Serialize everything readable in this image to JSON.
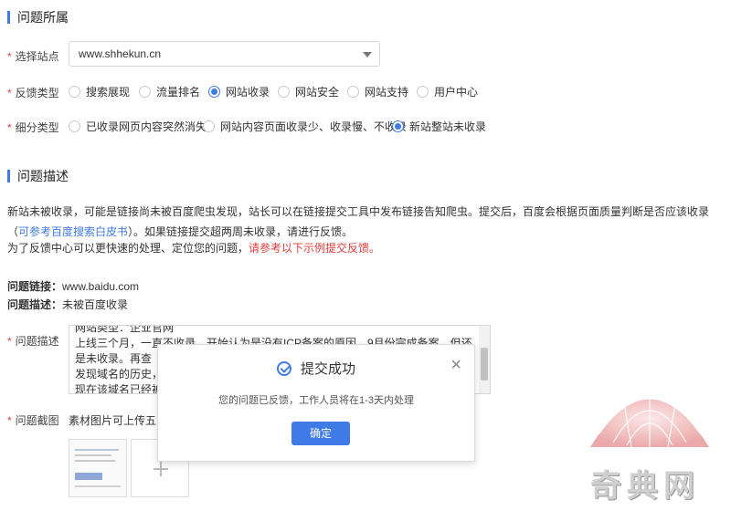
{
  "section1": {
    "title": "问题所属"
  },
  "site": {
    "label": "选择站点",
    "value": "www.shhekun.cn"
  },
  "feedback_type": {
    "label": "反馈类型",
    "options": [
      "搜索展现",
      "流量排名",
      "网站收录",
      "网站安全",
      "网站支持",
      "用户中心"
    ],
    "selected": "网站收录"
  },
  "sub_type": {
    "label": "细分类型",
    "options": [
      "已收录网页内容突然消失",
      "网站内容页面收录少、收录慢、不收录",
      "新站整站未收录"
    ],
    "selected": "新站整站未收录"
  },
  "section2": {
    "title": "问题描述"
  },
  "intro": {
    "text1": "新站未被收录，可能是链接尚未被百度爬虫发现，站长可以在链接提交工具中发布链接告知爬虫。提交后，百度会根据页面质量判断是否应该收录（",
    "link": "可参考百度搜索白皮书",
    "text2": "）。如果链接提交超两周未收录，请进行反馈。",
    "line2_prefix": "为了反馈中心可以更快速的处理、定位您的问题，",
    "line2_red": "请参考以下示例提交反馈。"
  },
  "example": {
    "link_label": "问题链接：",
    "link_value": "www.baidu.com",
    "desc_label": "问题描述：",
    "desc_value": "未被百度收录"
  },
  "description": {
    "label": "问题描述",
    "value": "网站类型：企业官网\n上线三个月，一直不收录，开始认为是没有ICP备案的原因，9月份完成备案，但还是未收录。再查\n发现域名的历史，在\n现在该域名已经被合\n理员给予本网站重新"
  },
  "screenshot": {
    "label": "问题截图",
    "tip": "素材图片可上传五张，"
  },
  "modal": {
    "title": "提交成功",
    "message": "您的问题已反馈，工作人员将在1-3天内处理",
    "confirm": "确定",
    "close": "×"
  },
  "watermark": {
    "text": "奇典网"
  },
  "colors": {
    "accent": "#3f7be6",
    "required": "#e03c3c"
  }
}
